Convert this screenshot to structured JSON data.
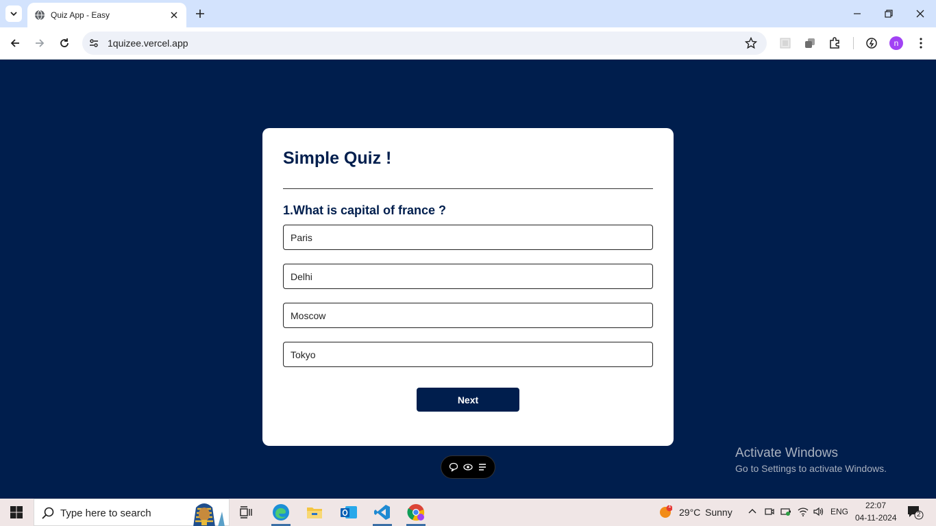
{
  "browser": {
    "tab_title": "Quiz App - Easy",
    "url": "1quizee.vercel.app",
    "profile_initial": "n"
  },
  "quiz": {
    "title": "Simple Quiz !",
    "question": "1.What is capital of france ?",
    "answers": [
      "Paris",
      "Delhi",
      "Moscow",
      "Tokyo"
    ],
    "next_label": "Next"
  },
  "watermark": {
    "line1": "Activate Windows",
    "line2": "Go to Settings to activate Windows."
  },
  "taskbar": {
    "search_placeholder": "Type here to search",
    "weather_temp": "29°C",
    "weather_desc": "Sunny",
    "weather_badge": "1",
    "language": "ENG",
    "time": "22:07",
    "date": "04-11-2024",
    "notification_count": "2"
  },
  "colors": {
    "page_bg": "#001e4d",
    "accent": "#001e4d",
    "tabstrip": "#d3e3fd",
    "profile": "#a142f4"
  }
}
